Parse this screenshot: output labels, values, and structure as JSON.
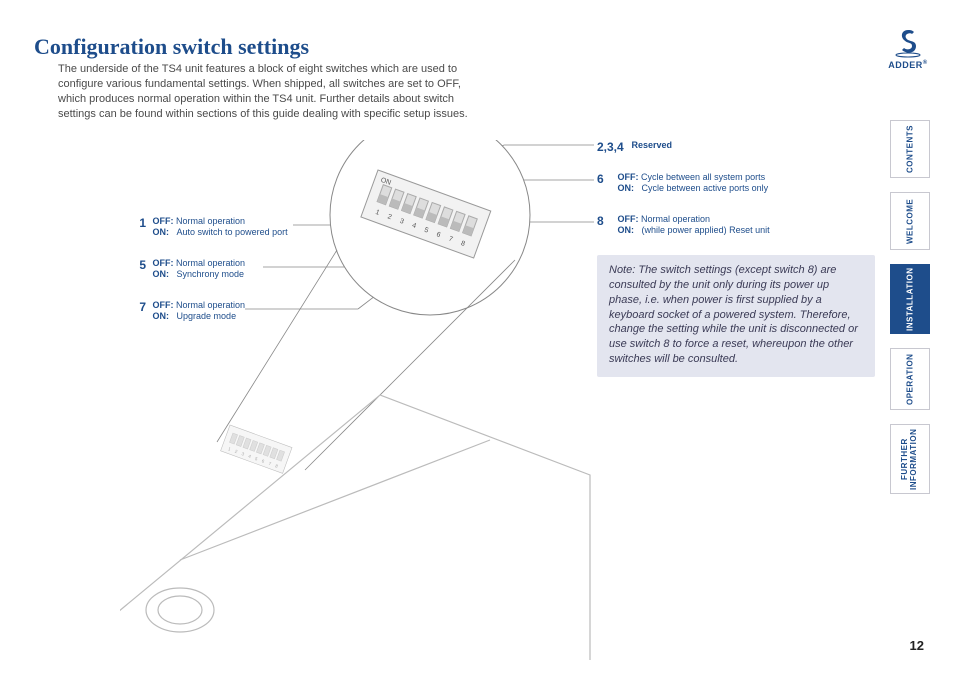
{
  "title": "Configuration switch settings",
  "intro": "The underside of the TS4 unit features a block of eight switches which are used to configure various fundamental settings. When shipped, all switches are set to OFF, which produces normal operation within the TS4 unit. Further details about switch settings can be found within sections of this guide dealing with specific setup issues.",
  "left_switches": [
    {
      "num": "1",
      "off": "Normal operation",
      "on": "Auto switch to powered port"
    },
    {
      "num": "5",
      "off": "Normal operation",
      "on": "Synchrony mode"
    },
    {
      "num": "7",
      "off": "Normal operation",
      "on": "Upgrade mode"
    }
  ],
  "right_switches": [
    {
      "num": "2,3,4",
      "reserved": "Reserved"
    },
    {
      "num": "6",
      "off": "Cycle between all system ports",
      "on": "Cycle between active ports only"
    },
    {
      "num": "8",
      "off": "Normal operation",
      "on": "(while power applied) Reset unit"
    }
  ],
  "labels": {
    "off": "OFF:",
    "on": "ON:"
  },
  "note": "Note: The switch settings (except switch 8) are consulted by the unit only during its power up phase, i.e. when power is first supplied by a keyboard socket of a powered system. Therefore, change the setting while the unit is disconnected or use switch 8 to force a reset, whereupon the other switches will be consulted.",
  "nav": {
    "contents": "CONTENTS",
    "welcome": "WELCOME",
    "installation": "INSTALLATION",
    "operation": "OPERATION",
    "further": "FURTHER\nINFORMATION"
  },
  "logo_text": "ADDER",
  "page_number": "12",
  "dip_labels": [
    "1",
    "2",
    "3",
    "4",
    "5",
    "6",
    "7",
    "8"
  ],
  "dip_on_label": "ON"
}
